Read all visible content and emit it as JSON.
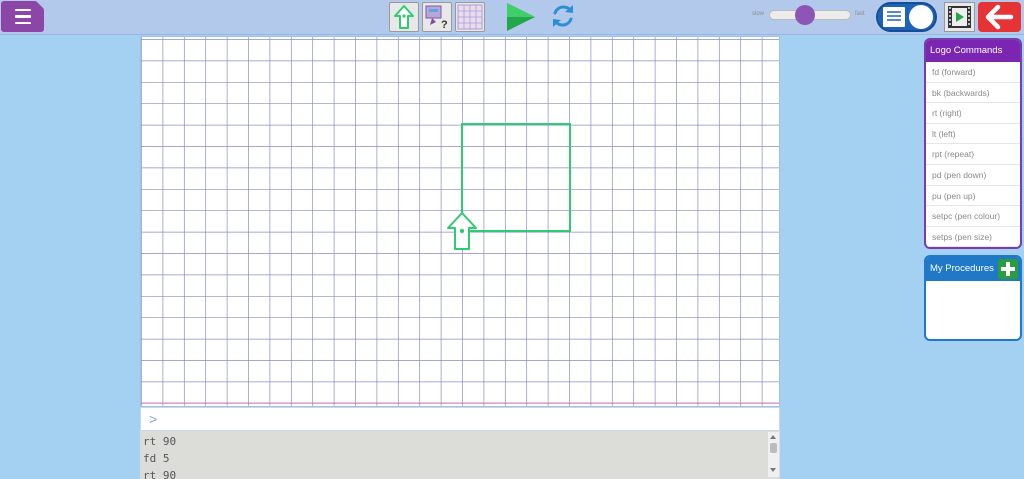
{
  "toolbar": {
    "menu_icon": "hamburger-icon",
    "turtle_icon": "turtle-arrow-icon",
    "help_icon": "help-question-icon",
    "grid_icon": "grid-icon",
    "play_icon": "play-icon",
    "reset_icon": "refresh-icon",
    "speed": {
      "slow_label": "slow",
      "fast_label": "fast",
      "value": 0.42
    },
    "view_toggle_icon": "panel-toggle-icon",
    "video_icon": "video-film-icon",
    "back_icon": "back-arrow-icon"
  },
  "canvas": {
    "grid": true,
    "turtle": {
      "pen_color": "#2ecc71",
      "icon": "turtle-arrow-icon"
    },
    "grid_color": "#8a8ac8",
    "axis_color": "#e06090"
  },
  "command_line": {
    "prompt": ">",
    "value": ""
  },
  "history": [
    "rt 90",
    "fd 5",
    "rt 90"
  ],
  "logo_panel": {
    "title": "Logo Commands",
    "commands": [
      "fd (forward)",
      "bk (backwards)",
      "rt (right)",
      "lt (left)",
      "rpt (repeat)",
      "pd (pen down)",
      "pu (pen up)",
      "setpc (pen colour)",
      "setps (pen size)"
    ]
  },
  "procedures_panel": {
    "title": "My Procedures",
    "add_icon": "plus-icon"
  }
}
